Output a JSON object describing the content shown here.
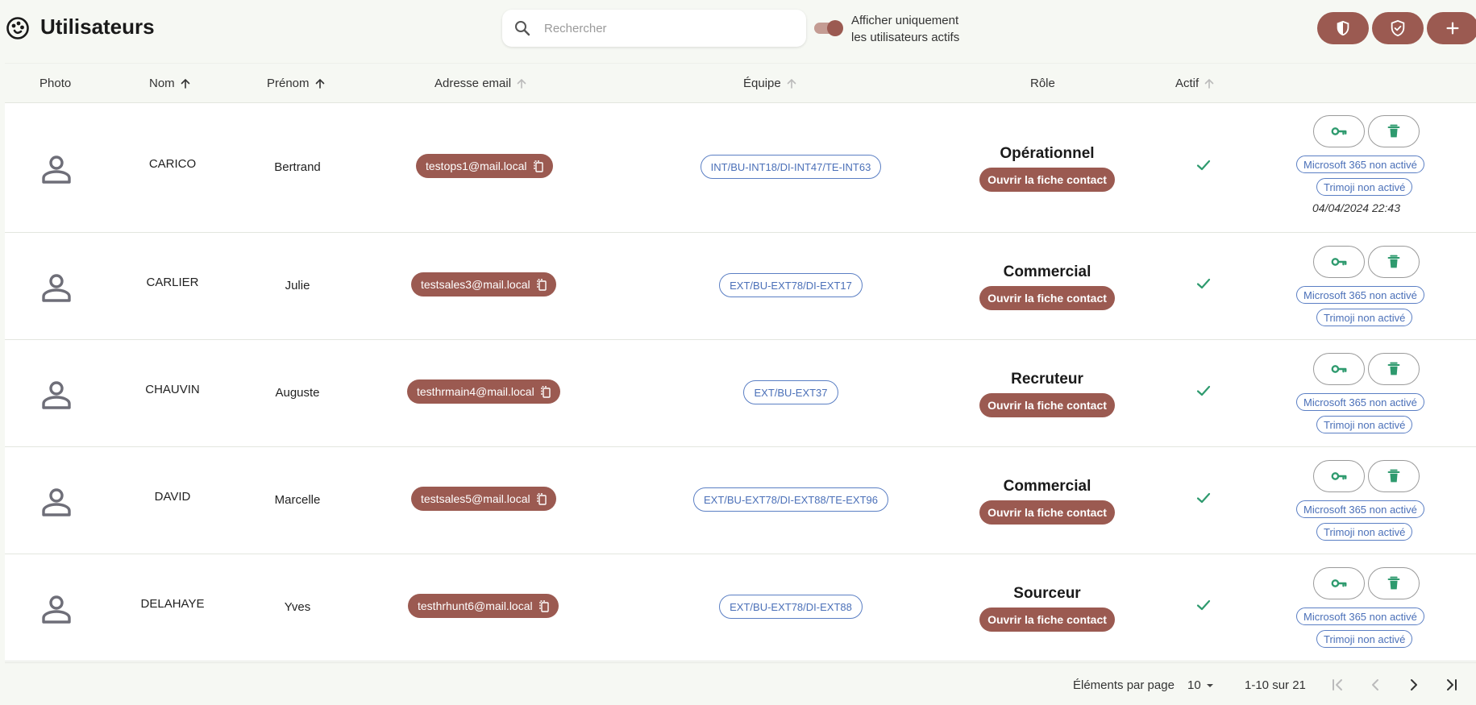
{
  "app": {
    "title": "Utilisateurs",
    "logo_icon": "palette-icon"
  },
  "search": {
    "placeholder": "Rechercher",
    "value": ""
  },
  "active_filter": {
    "line1": "Afficher uniquement",
    "line2": "les utilisateurs actifs",
    "checked": true
  },
  "header_actions": [
    {
      "name": "shield-half-icon"
    },
    {
      "name": "shield-check-icon"
    },
    {
      "name": "plus-icon"
    }
  ],
  "columns": {
    "photo": "Photo",
    "nom": "Nom",
    "prenom": "Prénom",
    "email": "Adresse email",
    "equipe": "Équipe",
    "role": "Rôle",
    "actif": "Actif"
  },
  "role_action_label": "Ouvrir la fiche contact",
  "users": [
    {
      "nom": "CARICO",
      "prenom": "Bertrand",
      "email": "testops1@mail.local",
      "equipe": "INT/BU-INT18/DI-INT47/TE-INT63",
      "role": "Opérationnel",
      "actif": true,
      "microsoft": "Microsoft 365 non activé",
      "trimoji": "Trimoji non activé",
      "date": "04/04/2024 22:43"
    },
    {
      "nom": "CARLIER",
      "prenom": "Julie",
      "email": "testsales3@mail.local",
      "equipe": "EXT/BU-EXT78/DI-EXT17",
      "role": "Commercial",
      "actif": true,
      "microsoft": "Microsoft 365 non activé",
      "trimoji": "Trimoji non activé",
      "date": ""
    },
    {
      "nom": "CHAUVIN",
      "prenom": "Auguste",
      "email": "testhrmain4@mail.local",
      "equipe": "EXT/BU-EXT37",
      "role": "Recruteur",
      "actif": true,
      "microsoft": "Microsoft 365 non activé",
      "trimoji": "Trimoji non activé",
      "date": ""
    },
    {
      "nom": "DAVID",
      "prenom": "Marcelle",
      "email": "testsales5@mail.local",
      "equipe": "EXT/BU-EXT78/DI-EXT88/TE-EXT96",
      "role": "Commercial",
      "actif": true,
      "microsoft": "Microsoft 365 non activé",
      "trimoji": "Trimoji non activé",
      "date": ""
    },
    {
      "nom": "DELAHAYE",
      "prenom": "Yves",
      "email": "testhrhunt6@mail.local",
      "equipe": "EXT/BU-EXT78/DI-EXT88",
      "role": "Sourceur",
      "actif": true,
      "microsoft": "Microsoft 365 non activé",
      "trimoji": "Trimoji non activé",
      "date": ""
    }
  ],
  "pagination": {
    "label": "Éléments par page",
    "page_size": "10",
    "range": "1-10 sur 21"
  },
  "colors": {
    "accent": "#9b5a51",
    "accent_light": "#c49c93",
    "tag_blue": "#4b70b8",
    "green": "#2e9a6e",
    "background": "#f6f8f3"
  }
}
